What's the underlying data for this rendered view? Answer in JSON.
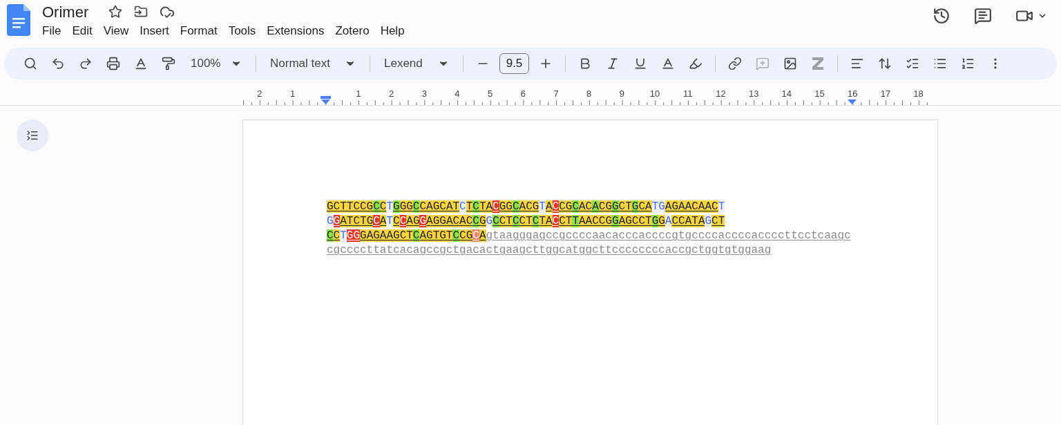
{
  "document": {
    "title": "Orimer"
  },
  "menu": [
    "File",
    "Edit",
    "View",
    "Insert",
    "Format",
    "Tools",
    "Extensions",
    "Zotero",
    "Help"
  ],
  "toolbar": {
    "zoom": "100%",
    "style": "Normal text",
    "font": "Lexend",
    "font_size": "9.5"
  },
  "ruler": {
    "left_labels": [
      "2",
      "1"
    ],
    "labels": [
      "1",
      "2",
      "3",
      "4",
      "5",
      "6",
      "7",
      "8",
      "9",
      "10",
      "11",
      "12",
      "13",
      "14",
      "15",
      "16",
      "17",
      "18"
    ]
  },
  "lines": [
    {
      "segments": [
        {
          "kind": "marked",
          "color": "#fcd440",
          "text": "GCTTCCG"
        },
        {
          "kind": "marked",
          "color": "#8ce24a",
          "text": "C"
        },
        {
          "kind": "marked",
          "color": "#fcd440",
          "text": "C"
        },
        {
          "kind": "plain",
          "text": "T"
        },
        {
          "kind": "marked",
          "color": "#8ce24a",
          "text": "G"
        },
        {
          "kind": "marked",
          "color": "#fcd440",
          "text": "GG"
        },
        {
          "kind": "marked",
          "color": "#8ce24a",
          "text": "C"
        },
        {
          "kind": "marked",
          "color": "#fcd440",
          "text": "CAGCAT"
        },
        {
          "kind": "plain",
          "text": "C"
        },
        {
          "kind": "marked",
          "color": "#fcd440",
          "text": "T"
        },
        {
          "kind": "marked",
          "color": "#8ce24a",
          "text": "C"
        },
        {
          "kind": "marked",
          "color": "#fcd440",
          "text": "TA"
        },
        {
          "kind": "marked",
          "color": "#e8362a",
          "text": "C"
        },
        {
          "kind": "marked",
          "color": "#fcd440",
          "text": "GG"
        },
        {
          "kind": "marked",
          "color": "#8ce24a",
          "text": "C"
        },
        {
          "kind": "marked",
          "color": "#fcd440",
          "text": "ACG"
        },
        {
          "kind": "plain",
          "text": "T"
        },
        {
          "kind": "marked",
          "color": "#fcd440",
          "text": "A"
        },
        {
          "kind": "marked",
          "color": "#e8362a",
          "text": "C"
        },
        {
          "kind": "marked",
          "color": "#fcd440",
          "text": "CG"
        },
        {
          "kind": "marked",
          "color": "#8ce24a",
          "text": "C"
        },
        {
          "kind": "marked",
          "color": "#fcd440",
          "text": "AC"
        },
        {
          "kind": "marked",
          "color": "#8ce24a",
          "text": "A"
        },
        {
          "kind": "marked",
          "color": "#fcd440",
          "text": "CG"
        },
        {
          "kind": "marked",
          "color": "#8ce24a",
          "text": "G"
        },
        {
          "kind": "marked",
          "color": "#fcd440",
          "text": "CT"
        },
        {
          "kind": "marked",
          "color": "#8ce24a",
          "text": "G"
        },
        {
          "kind": "marked",
          "color": "#fcd440",
          "text": "CA"
        },
        {
          "kind": "plain",
          "text": "TG"
        },
        {
          "kind": "marked",
          "color": "#fcd440",
          "text": "AGAACAAC"
        },
        {
          "kind": "plain",
          "text": "T"
        }
      ]
    },
    {
      "segments": [
        {
          "kind": "plain",
          "text": "G"
        },
        {
          "kind": "marked",
          "color": "#e8362a",
          "text": "G"
        },
        {
          "kind": "marked",
          "color": "#fcd440",
          "text": "ATCTG"
        },
        {
          "kind": "marked",
          "color": "#e8362a",
          "text": "C"
        },
        {
          "kind": "marked",
          "color": "#fcd440",
          "text": "A"
        },
        {
          "kind": "plain",
          "text": "T"
        },
        {
          "kind": "marked",
          "color": "#fcd440",
          "text": "C"
        },
        {
          "kind": "marked",
          "color": "#e8362a",
          "text": "C"
        },
        {
          "kind": "marked",
          "color": "#fcd440",
          "text": "AG"
        },
        {
          "kind": "marked",
          "color": "#e8362a",
          "text": "G"
        },
        {
          "kind": "marked",
          "color": "#fcd440",
          "text": "AGGACAC"
        },
        {
          "kind": "marked",
          "color": "#8ce24a",
          "text": "C"
        },
        {
          "kind": "marked",
          "color": "#fcd440",
          "text": "G"
        },
        {
          "kind": "plain",
          "text": "G"
        },
        {
          "kind": "marked",
          "color": "#8ce24a",
          "text": "C"
        },
        {
          "kind": "marked",
          "color": "#fcd440",
          "text": "CT"
        },
        {
          "kind": "marked",
          "color": "#8ce24a",
          "text": "C"
        },
        {
          "kind": "marked",
          "color": "#fcd440",
          "text": "CT"
        },
        {
          "kind": "marked",
          "color": "#8ce24a",
          "text": "C"
        },
        {
          "kind": "marked",
          "color": "#fcd440",
          "text": "TA"
        },
        {
          "kind": "marked",
          "color": "#e8362a",
          "text": "C"
        },
        {
          "kind": "marked",
          "color": "#fcd440",
          "text": "CT"
        },
        {
          "kind": "marked",
          "color": "#8ce24a",
          "text": "T"
        },
        {
          "kind": "marked",
          "color": "#fcd440",
          "text": "AACCG"
        },
        {
          "kind": "marked",
          "color": "#8ce24a",
          "text": "G"
        },
        {
          "kind": "marked",
          "color": "#fcd440",
          "text": "AGCCT"
        },
        {
          "kind": "marked",
          "color": "#8ce24a",
          "text": "G"
        },
        {
          "kind": "marked",
          "color": "#fcd440",
          "text": "G"
        },
        {
          "kind": "plain",
          "text": "A"
        },
        {
          "kind": "marked",
          "color": "#fcd440",
          "text": "CCATA"
        },
        {
          "kind": "plain",
          "text": "G"
        },
        {
          "kind": "marked",
          "color": "#fcd440",
          "text": "CT"
        }
      ]
    },
    {
      "segments": [
        {
          "kind": "marked",
          "color": "#8ce24a",
          "text": "C"
        },
        {
          "kind": "marked",
          "color": "#fcd440",
          "text": "C"
        },
        {
          "kind": "plain",
          "text": "T"
        },
        {
          "kind": "marked",
          "color": "#e8362a",
          "text": "GG"
        },
        {
          "kind": "marked",
          "color": "#fcd440",
          "text": "GAGAAGCT"
        },
        {
          "kind": "marked",
          "color": "#8ce24a",
          "text": "C"
        },
        {
          "kind": "marked",
          "color": "#fcd440",
          "text": "AGTGT"
        },
        {
          "kind": "marked",
          "color": "#8ce24a",
          "text": "C"
        },
        {
          "kind": "marked",
          "color": "#fcd440",
          "text": "CG"
        },
        {
          "kind": "marked",
          "color": "#f08a6a",
          "text": "C"
        },
        {
          "kind": "marked",
          "color": "#fcd440",
          "text": "A"
        },
        {
          "kind": "intron",
          "text": "gtaagggagccgccccaacacccaccccgtgccccaccccaccccttcctcaagc"
        }
      ]
    },
    {
      "segments": [
        {
          "kind": "intron",
          "text": "cgccccttatcacagccgctgacactgaagcttggcatggcttccccccccaccgctggtgtggaag"
        }
      ]
    }
  ]
}
